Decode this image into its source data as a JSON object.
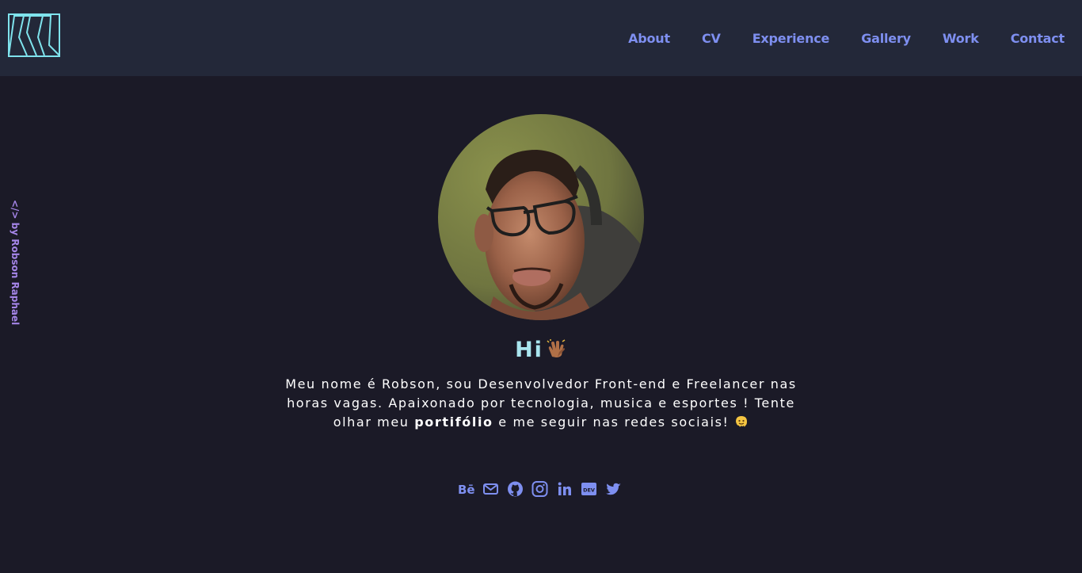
{
  "header": {
    "logo_name": "rr-monogram-logo",
    "nav": [
      "About",
      "CV",
      "Experience",
      "Gallery",
      "Work",
      "Contact"
    ]
  },
  "side_credit": "</> by Robson Raphael",
  "hero": {
    "greeting": "Hi",
    "intro_before": "Meu nome é Robson, sou Desenvolvedor Front-end e Freelancer nas horas vagas. Apaixonado por tecnologia, musica e esportes ! Tente olhar meu ",
    "intro_bold": "portifólio",
    "intro_after": " e me seguir nas redes sociais! "
  },
  "social_icons": [
    "behance-icon",
    "mail-icon",
    "github-icon",
    "instagram-icon",
    "linkedin-icon",
    "dev-icon",
    "twitter-icon"
  ],
  "colors": {
    "background": "#1b1a27",
    "header": "#232839",
    "nav_link": "#7e8ff0",
    "greeting": "#a9e5ef",
    "side_credit": "#a585e8",
    "logo": "#7fe3ed"
  }
}
